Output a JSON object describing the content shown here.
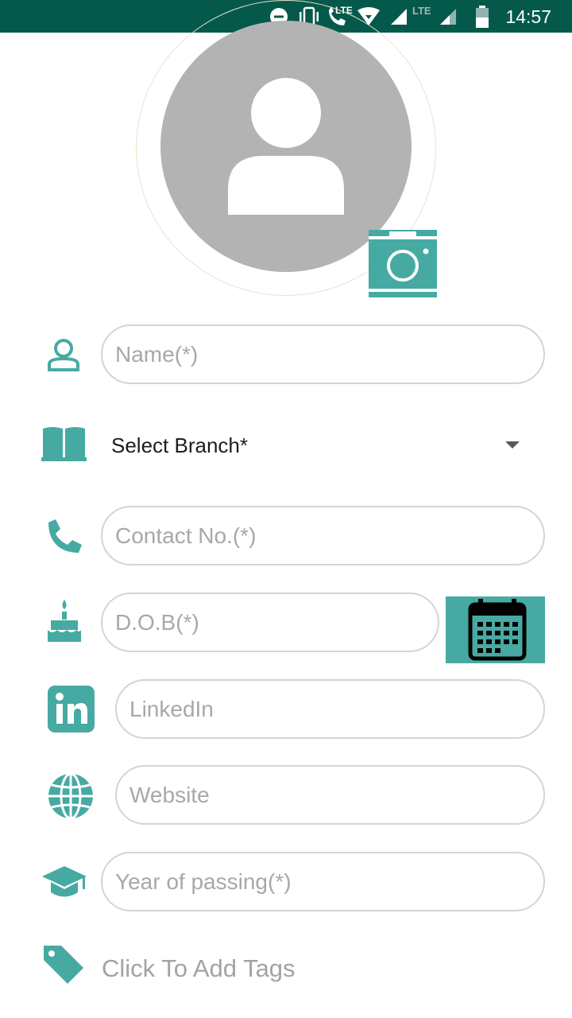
{
  "status_bar": {
    "time": "14:57",
    "network_label": "LTE",
    "network_label_2": "LTE",
    "icons": [
      "do-not-disturb-icon",
      "vibrate-icon",
      "volte-call-icon",
      "wifi-icon",
      "signal-icon",
      "signal-icon",
      "battery-icon"
    ]
  },
  "profile": {
    "avatar_icon": "person-placeholder-icon",
    "camera_icon": "camera-icon"
  },
  "form": {
    "name_placeholder": "Name(*)",
    "branch_select_label": "Select Branch*",
    "contact_placeholder": "Contact No.(*)",
    "dob_placeholder": "D.O.B(*)",
    "linkedin_placeholder": "LinkedIn",
    "website_placeholder": "Website",
    "year_placeholder": "Year of passing(*)",
    "tags_label": "Click To Add Tags"
  },
  "colors": {
    "accent": "#46aaa3",
    "status_bar": "#04594b",
    "avatar_bg": "#b3b3b3",
    "placeholder": "#a8a8a8"
  }
}
